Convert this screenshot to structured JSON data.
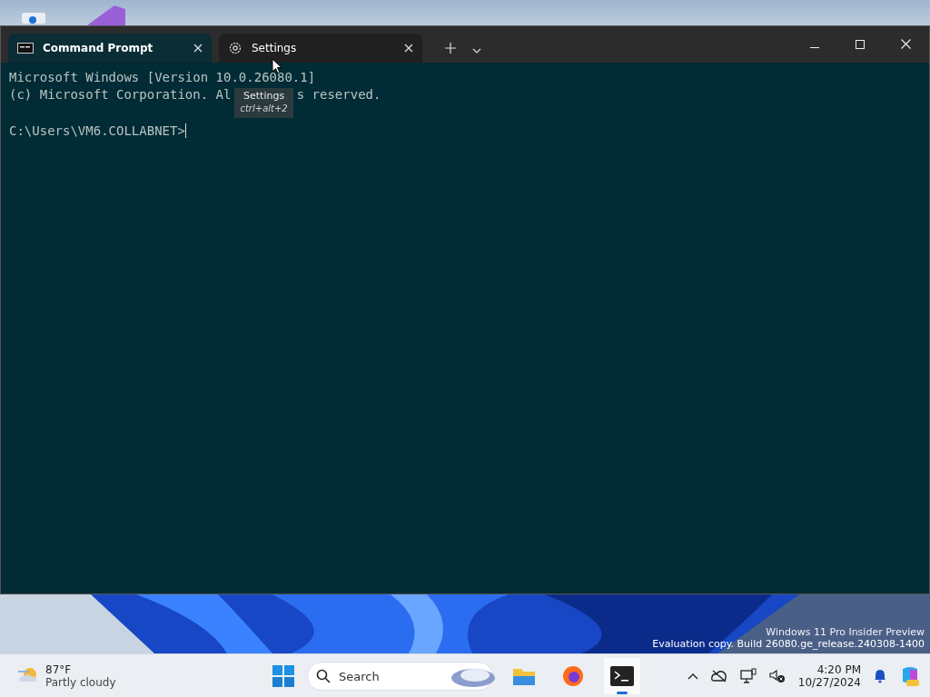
{
  "window": {
    "tabs": [
      {
        "label": "Command Prompt",
        "kind": "cmd",
        "selected": true
      },
      {
        "label": "Settings",
        "kind": "gear",
        "selected": false
      }
    ],
    "tooltip": {
      "title": "Settings",
      "shortcut": "ctrl+alt+2"
    },
    "terminal": {
      "lines": [
        {
          "parts": [
            "Microsoft Windows [Version 10.0.26080.1]"
          ]
        },
        {
          "parts": [
            "(c) Microsoft Corporation. Al",
            "s reserved."
          ]
        }
      ],
      "prompt": "C:\\Users\\VM6.COLLABNET>"
    }
  },
  "desktop": {
    "watermark": [
      "Windows 11 Pro Insider Preview",
      "Evaluation copy. Build 26080.ge_release.240308-1400"
    ]
  },
  "taskbar": {
    "weather": {
      "temperature": "87°F",
      "condition": "Partly cloudy"
    },
    "search": {
      "placeholder": "Search"
    },
    "apps": [
      {
        "kind": "folder",
        "running": false
      },
      {
        "kind": "browser",
        "running": false
      },
      {
        "kind": "terminal",
        "running": true
      }
    ],
    "clock": {
      "time": "4:20 PM",
      "date": "10/27/2024"
    }
  }
}
